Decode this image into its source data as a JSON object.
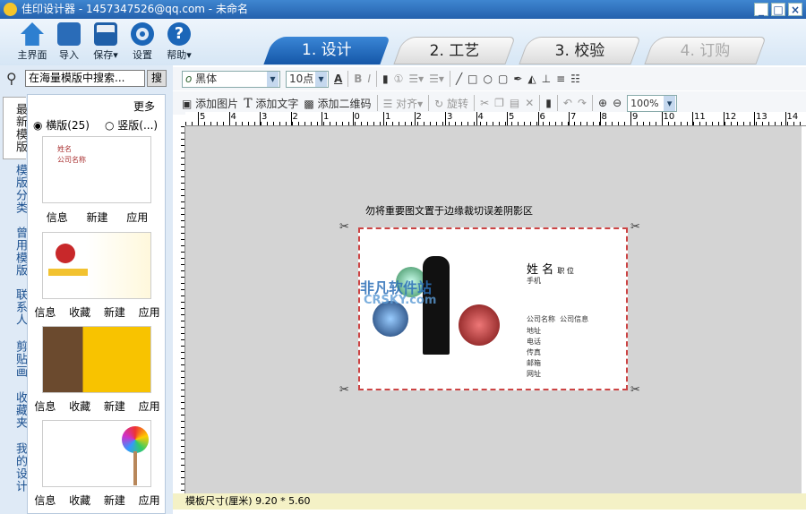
{
  "window": {
    "title": "佳印设计器 - 1457347526@qq.com - 未命名",
    "controls": [
      "_",
      "□",
      "×"
    ]
  },
  "toolbar": [
    {
      "label": "主界面",
      "icon": "home-icon"
    },
    {
      "label": "导入",
      "icon": "import-icon"
    },
    {
      "label": "保存▾",
      "icon": "save-icon"
    },
    {
      "label": "设置",
      "icon": "gear-icon"
    },
    {
      "label": "帮助▾",
      "icon": "help-icon"
    }
  ],
  "tabs": [
    "1. 设计",
    "2. 工艺",
    "3. 校验",
    "4. 订购"
  ],
  "search": {
    "placeholder": "在海量模版中搜索...",
    "button": "搜"
  },
  "side_tabs": [
    "最新模版",
    "模版分类",
    "曾用模版",
    "联系人",
    "剪贴画",
    "收藏夹",
    "我的设计"
  ],
  "panel": {
    "more": "更多",
    "radio_h": "横版(25)",
    "radio_v": "竖版(...)",
    "templates": [
      {
        "actions": [
          "信息",
          "新建",
          "应用"
        ]
      },
      {
        "actions": [
          "信息",
          "收藏",
          "新建",
          "应用"
        ]
      },
      {
        "actions": [
          "信息",
          "收藏",
          "新建",
          "应用"
        ]
      },
      {
        "actions": [
          "信息",
          "收藏",
          "新建",
          "应用"
        ]
      }
    ]
  },
  "format": {
    "font": "黑体",
    "size": "10点",
    "zoom": "100%"
  },
  "edit": {
    "add_image": "添加图片",
    "add_text": "添加文字",
    "add_qr": "添加二维码",
    "align": "对齐▾",
    "rotate": "旋转"
  },
  "ruler": [
    "5",
    "4",
    "3",
    "2",
    "1",
    "0",
    "1",
    "2",
    "3",
    "4",
    "5",
    "6",
    "7",
    "8",
    "9",
    "10",
    "11",
    "12",
    "13",
    "14"
  ],
  "canvas": {
    "warning": "勿将重要图文置于边缘裁切误差阴影区",
    "card": {
      "name": "姓 名",
      "title": "职 位",
      "mobile": "手机",
      "company": "公司名称",
      "company_info": "公司信息",
      "fields": [
        "地址",
        "电话",
        "传真",
        "邮箱",
        "网址"
      ]
    },
    "watermark": "非凡软件站",
    "watermark2": "CRSKY.com"
  },
  "status": "模板尺寸(厘米) 9.20 * 5.60"
}
